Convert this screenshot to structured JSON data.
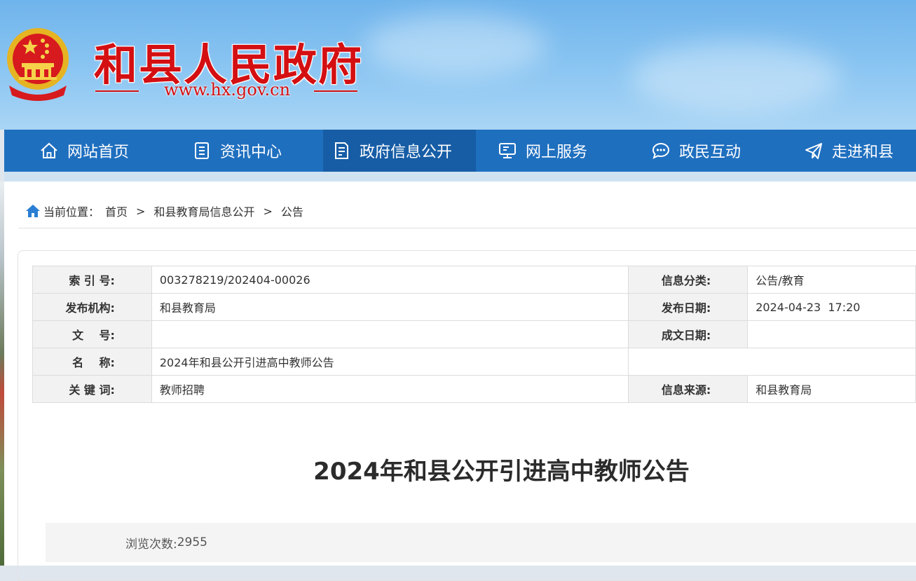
{
  "header": {
    "title": "和县人民政府",
    "url": "www.hx.gov.cn"
  },
  "nav": {
    "items": [
      {
        "label": "网站首页",
        "icon": "home-icon"
      },
      {
        "label": "资讯中心",
        "icon": "document-icon"
      },
      {
        "label": "政府信息公开",
        "icon": "file-list-icon",
        "active": true
      },
      {
        "label": "网上服务",
        "icon": "monitor-icon"
      },
      {
        "label": "政民互动",
        "icon": "chat-icon"
      },
      {
        "label": "走进和县",
        "icon": "paper-plane-icon"
      }
    ]
  },
  "breadcrumb": {
    "prefix": "当前位置：",
    "items": [
      "首页",
      "和县教育局信息公开",
      "公告"
    ],
    "separator": ">"
  },
  "meta": {
    "index_no_label": "索 引 号:",
    "index_no": "003278219/202404-00026",
    "category_label": "信息分类:",
    "category": "公告/教育",
    "publisher_label": "发布机构:",
    "publisher": "和县教育局",
    "publish_date_label": "发布日期:",
    "publish_date": "2024-04-23  17:20",
    "doc_no_label": "文    号:",
    "doc_no": "",
    "created_date_label": "成文日期:",
    "created_date": "",
    "name_label": "名    称:",
    "name": "2024年和县公开引进高中教师公告",
    "keywords_label": "关 键 词:",
    "keywords": "教师招聘",
    "source_label": "信息来源:",
    "source": "和县教育局"
  },
  "article": {
    "title": "2024年和县公开引进高中教师公告",
    "views_label": "浏览次数:",
    "views": "2955"
  },
  "colors": {
    "nav_bg": "#1f6fbf",
    "nav_active": "#175da6",
    "title_red": "#d40f12"
  }
}
